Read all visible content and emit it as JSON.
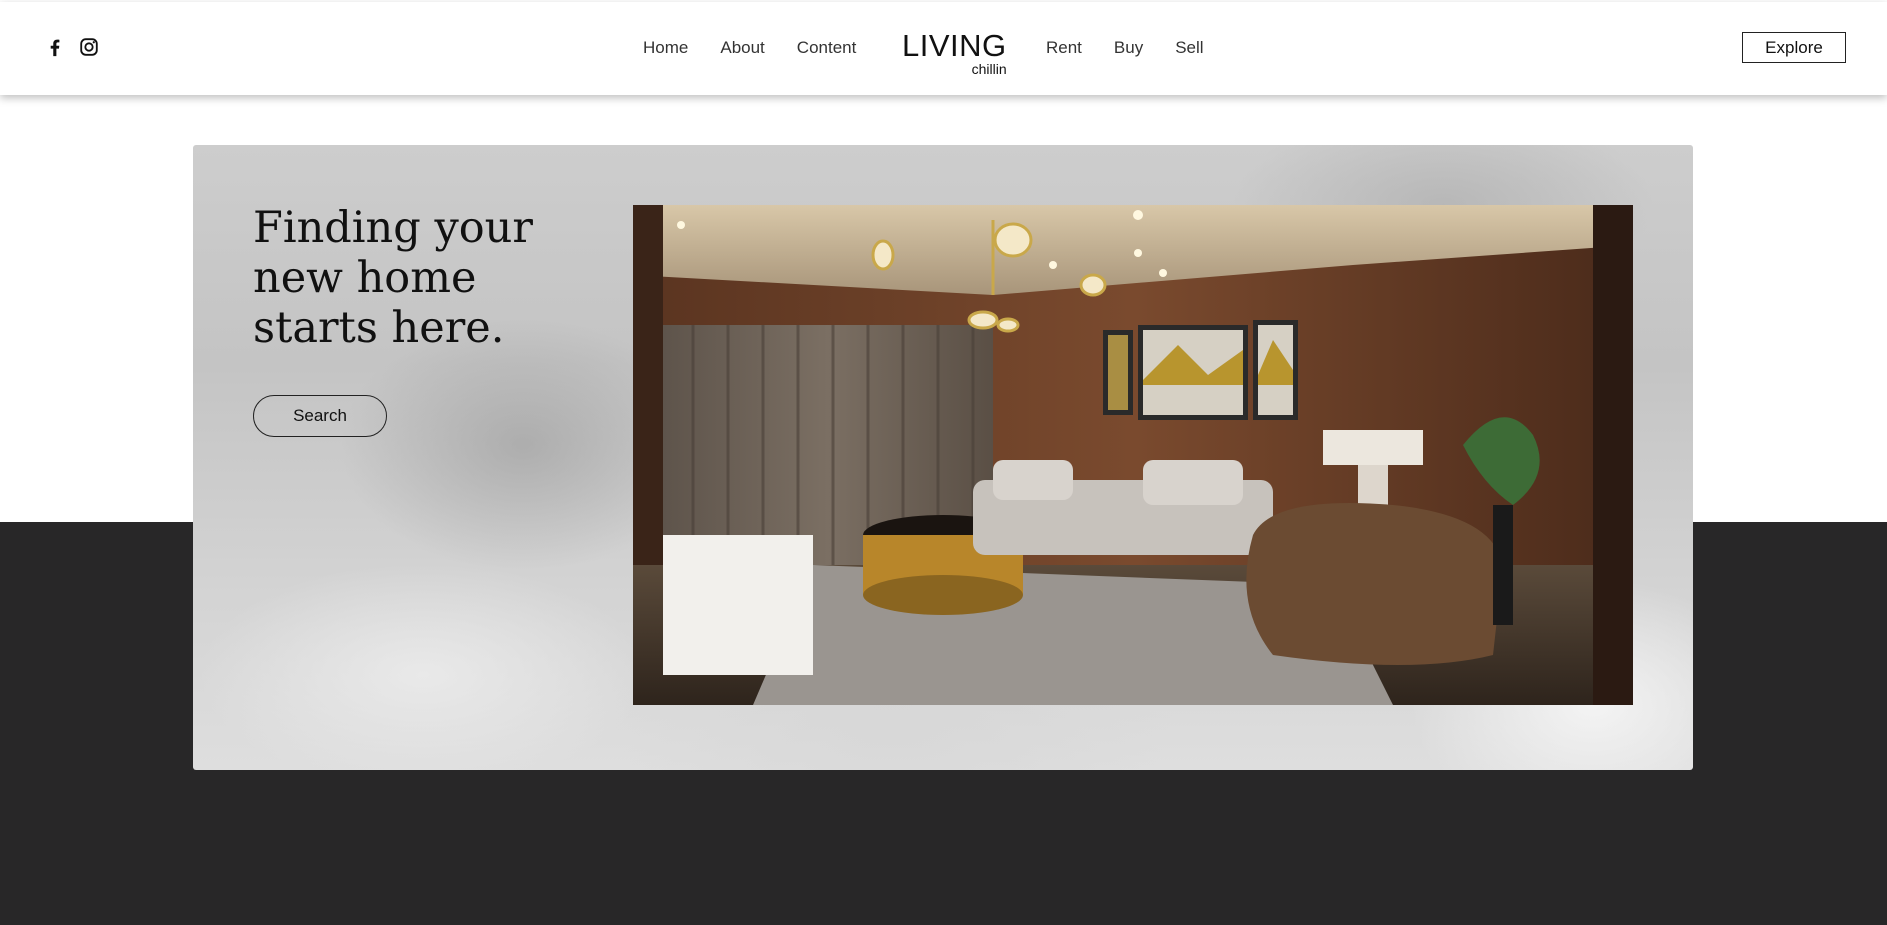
{
  "header": {
    "social": [
      {
        "icon": "facebook-icon"
      },
      {
        "icon": "instagram-icon"
      }
    ],
    "nav_left": [
      "Home",
      "About",
      "Content"
    ],
    "nav_right": [
      "Rent",
      "Buy",
      "Sell"
    ],
    "logo": {
      "main": "LIVING",
      "sub": "chillin"
    },
    "explore_label": "Explore"
  },
  "hero": {
    "headline": "Finding your new home starts here.",
    "search_label": "Search",
    "image_icon": "living-room-photo"
  },
  "colors": {
    "background": "#ffffff",
    "dark_band": "#282728",
    "hero_card": "#c9c9c9",
    "text": "#111111"
  }
}
